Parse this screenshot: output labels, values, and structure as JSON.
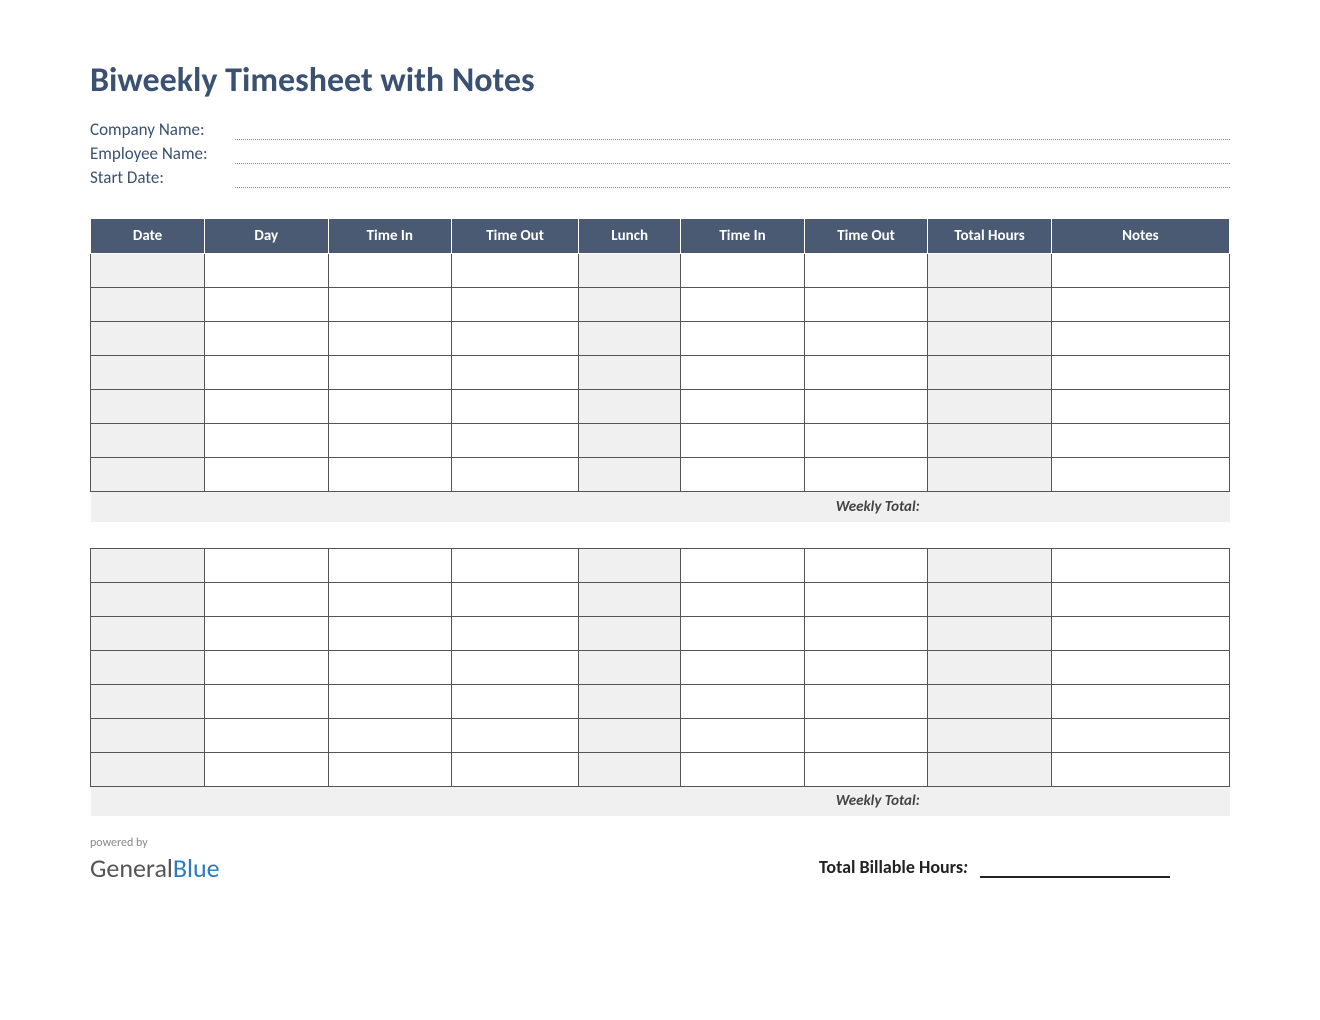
{
  "title": "Biweekly Timesheet with Notes",
  "meta": {
    "company_label": "Company Name:",
    "employee_label": "Employee Name:",
    "start_date_label": "Start Date:",
    "company_value": "",
    "employee_value": "",
    "start_date_value": ""
  },
  "headers": {
    "date": "Date",
    "day": "Day",
    "time_in_1": "Time In",
    "time_out_1": "Time Out",
    "lunch": "Lunch",
    "time_in_2": "Time In",
    "time_out_2": "Time Out",
    "total_hours": "Total Hours",
    "notes": "Notes"
  },
  "week1": {
    "rows": [
      {
        "date": "",
        "day": "",
        "in1": "",
        "out1": "",
        "lunch": "",
        "in2": "",
        "out2": "",
        "total": "",
        "notes": ""
      },
      {
        "date": "",
        "day": "",
        "in1": "",
        "out1": "",
        "lunch": "",
        "in2": "",
        "out2": "",
        "total": "",
        "notes": ""
      },
      {
        "date": "",
        "day": "",
        "in1": "",
        "out1": "",
        "lunch": "",
        "in2": "",
        "out2": "",
        "total": "",
        "notes": ""
      },
      {
        "date": "",
        "day": "",
        "in1": "",
        "out1": "",
        "lunch": "",
        "in2": "",
        "out2": "",
        "total": "",
        "notes": ""
      },
      {
        "date": "",
        "day": "",
        "in1": "",
        "out1": "",
        "lunch": "",
        "in2": "",
        "out2": "",
        "total": "",
        "notes": ""
      },
      {
        "date": "",
        "day": "",
        "in1": "",
        "out1": "",
        "lunch": "",
        "in2": "",
        "out2": "",
        "total": "",
        "notes": ""
      },
      {
        "date": "",
        "day": "",
        "in1": "",
        "out1": "",
        "lunch": "",
        "in2": "",
        "out2": "",
        "total": "",
        "notes": ""
      }
    ],
    "weekly_total_label": "Weekly Total:",
    "weekly_total_value": ""
  },
  "week2": {
    "rows": [
      {
        "date": "",
        "day": "",
        "in1": "",
        "out1": "",
        "lunch": "",
        "in2": "",
        "out2": "",
        "total": "",
        "notes": ""
      },
      {
        "date": "",
        "day": "",
        "in1": "",
        "out1": "",
        "lunch": "",
        "in2": "",
        "out2": "",
        "total": "",
        "notes": ""
      },
      {
        "date": "",
        "day": "",
        "in1": "",
        "out1": "",
        "lunch": "",
        "in2": "",
        "out2": "",
        "total": "",
        "notes": ""
      },
      {
        "date": "",
        "day": "",
        "in1": "",
        "out1": "",
        "lunch": "",
        "in2": "",
        "out2": "",
        "total": "",
        "notes": ""
      },
      {
        "date": "",
        "day": "",
        "in1": "",
        "out1": "",
        "lunch": "",
        "in2": "",
        "out2": "",
        "total": "",
        "notes": ""
      },
      {
        "date": "",
        "day": "",
        "in1": "",
        "out1": "",
        "lunch": "",
        "in2": "",
        "out2": "",
        "total": "",
        "notes": ""
      },
      {
        "date": "",
        "day": "",
        "in1": "",
        "out1": "",
        "lunch": "",
        "in2": "",
        "out2": "",
        "total": "",
        "notes": ""
      }
    ],
    "weekly_total_label": "Weekly Total:",
    "weekly_total_value": ""
  },
  "footer": {
    "powered_by": "powered by",
    "logo_general": "General",
    "logo_blue": "Blue",
    "billable_label": "Total Billable Hours",
    "billable_value": ""
  }
}
